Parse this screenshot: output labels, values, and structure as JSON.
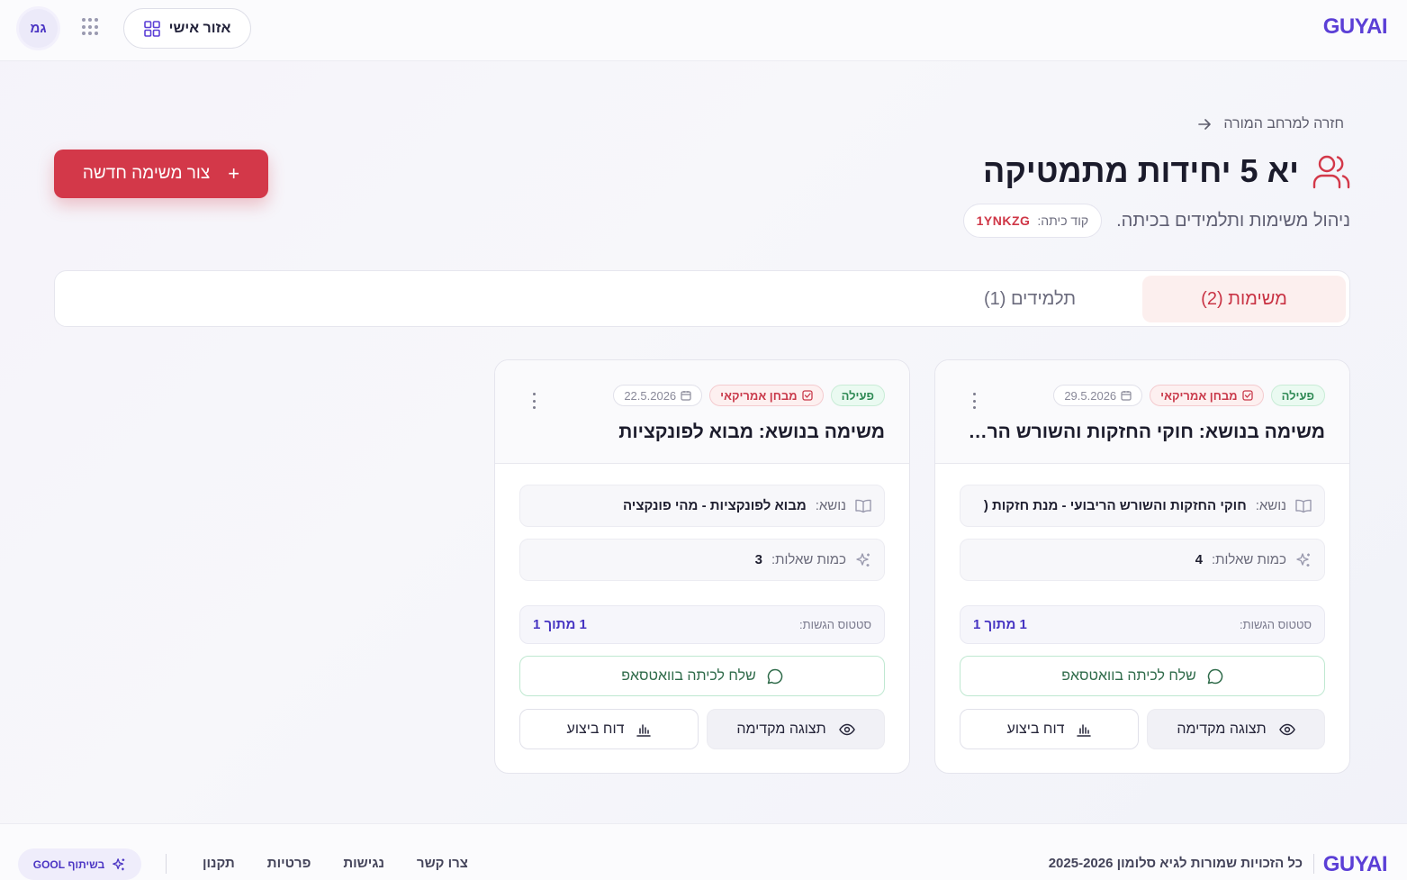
{
  "header": {
    "logo": "GUYAI",
    "personal_area_label": "אזור אישי",
    "avatar_initials": "גמ"
  },
  "page": {
    "back_label": "חזרה למרחב המורה",
    "title": "יא 5 יחידות מתמטיקה",
    "subtitle": "ניהול משימות ותלמידים בכיתה.",
    "class_code_label": "קוד כיתה:",
    "class_code": "1YNKZG",
    "new_task_label": "צור משימה חדשה"
  },
  "tabs": {
    "tasks": "משימות (2)",
    "students": "תלמידים (1)"
  },
  "cards": [
    {
      "status": "פעילה",
      "type": "מבחן אמריקאי",
      "date": "29.5.2026",
      "title": "משימה בנושא: חוקי החזקות והשורש הריבועי - מנת חזקות (",
      "topic_label": "נושא:",
      "topic": "חוקי החזקות והשורש הריבועי - מנת חזקות (",
      "count_label": "כמות שאלות:",
      "count": "4",
      "submission_label": "סטטוס הגשות:",
      "submission": "1 מתוך 1",
      "whatsapp_label": "שלח לכיתה בוואטסאפ",
      "preview_label": "תצוגה מקדימה",
      "report_label": "דוח ביצוע"
    },
    {
      "status": "פעילה",
      "type": "מבחן אמריקאי",
      "date": "22.5.2026",
      "title": "משימה בנושא: מבוא לפונקציות",
      "topic_label": "נושא:",
      "topic": "מבוא לפונקציות - מהי פונקציה",
      "count_label": "כמות שאלות:",
      "count": "3",
      "submission_label": "סטטוס הגשות:",
      "submission": "1 מתוך 1",
      "whatsapp_label": "שלח לכיתה בוואטסאפ",
      "preview_label": "תצוגה מקדימה",
      "report_label": "דוח ביצוע"
    }
  ],
  "footer": {
    "logo": "GUYAI",
    "copyright": "כל הזכויות שמורות לגיא סלומון 2025-2026",
    "links": [
      "צרו קשר",
      "נגישות",
      "פרטיות",
      "תקנון"
    ],
    "partner_badge": "בשיתוף GOOL"
  },
  "colors": {
    "brand": "#5b3fd6",
    "accent": "#d33849",
    "active": "#2f8a55"
  }
}
